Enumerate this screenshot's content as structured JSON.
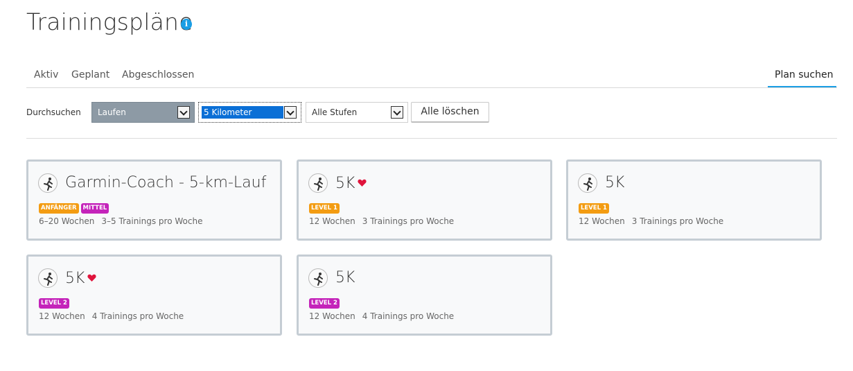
{
  "page": {
    "title": "Trainingspläne",
    "info_icon": "i"
  },
  "tabs": [
    {
      "label": "Aktiv"
    },
    {
      "label": "Geplant"
    },
    {
      "label": "Abgeschlossen"
    },
    {
      "label": "Plan suchen",
      "active": true
    }
  ],
  "filters": {
    "label": "Durchsuchen",
    "sport": "Laufen",
    "distance": "5 Kilometer",
    "level": "Alle Stufen",
    "clear_button": "Alle löschen"
  },
  "colors": {
    "accent": "#1a9ee5",
    "badge_orange": "#f39c12",
    "badge_magenta": "#c424ba",
    "heart": "#e0143c"
  },
  "plans": [
    {
      "title": "Garmin-Coach - 5-km-Lauf",
      "favorite": false,
      "badges": [
        {
          "text": "ANFÄNGER",
          "color": "orange"
        },
        {
          "text": "MITTEL",
          "color": "magenta"
        }
      ],
      "weeks": "6–20 Wochen",
      "per_week": "3–5 Trainings pro Woche"
    },
    {
      "title": "5K",
      "favorite": true,
      "badges": [
        {
          "text": "LEVEL 1",
          "color": "orange"
        }
      ],
      "weeks": "12 Wochen",
      "per_week": "3 Trainings pro Woche"
    },
    {
      "title": "5K",
      "favorite": false,
      "badges": [
        {
          "text": "LEVEL 1",
          "color": "orange"
        }
      ],
      "weeks": "12 Wochen",
      "per_week": "3 Trainings pro Woche"
    },
    {
      "title": "5K",
      "favorite": true,
      "badges": [
        {
          "text": "LEVEL 2",
          "color": "magenta"
        }
      ],
      "weeks": "12 Wochen",
      "per_week": "4 Trainings pro Woche"
    },
    {
      "title": "5K",
      "favorite": false,
      "badges": [
        {
          "text": "LEVEL 2",
          "color": "magenta"
        }
      ],
      "weeks": "12 Wochen",
      "per_week": "4 Trainings pro Woche"
    }
  ]
}
